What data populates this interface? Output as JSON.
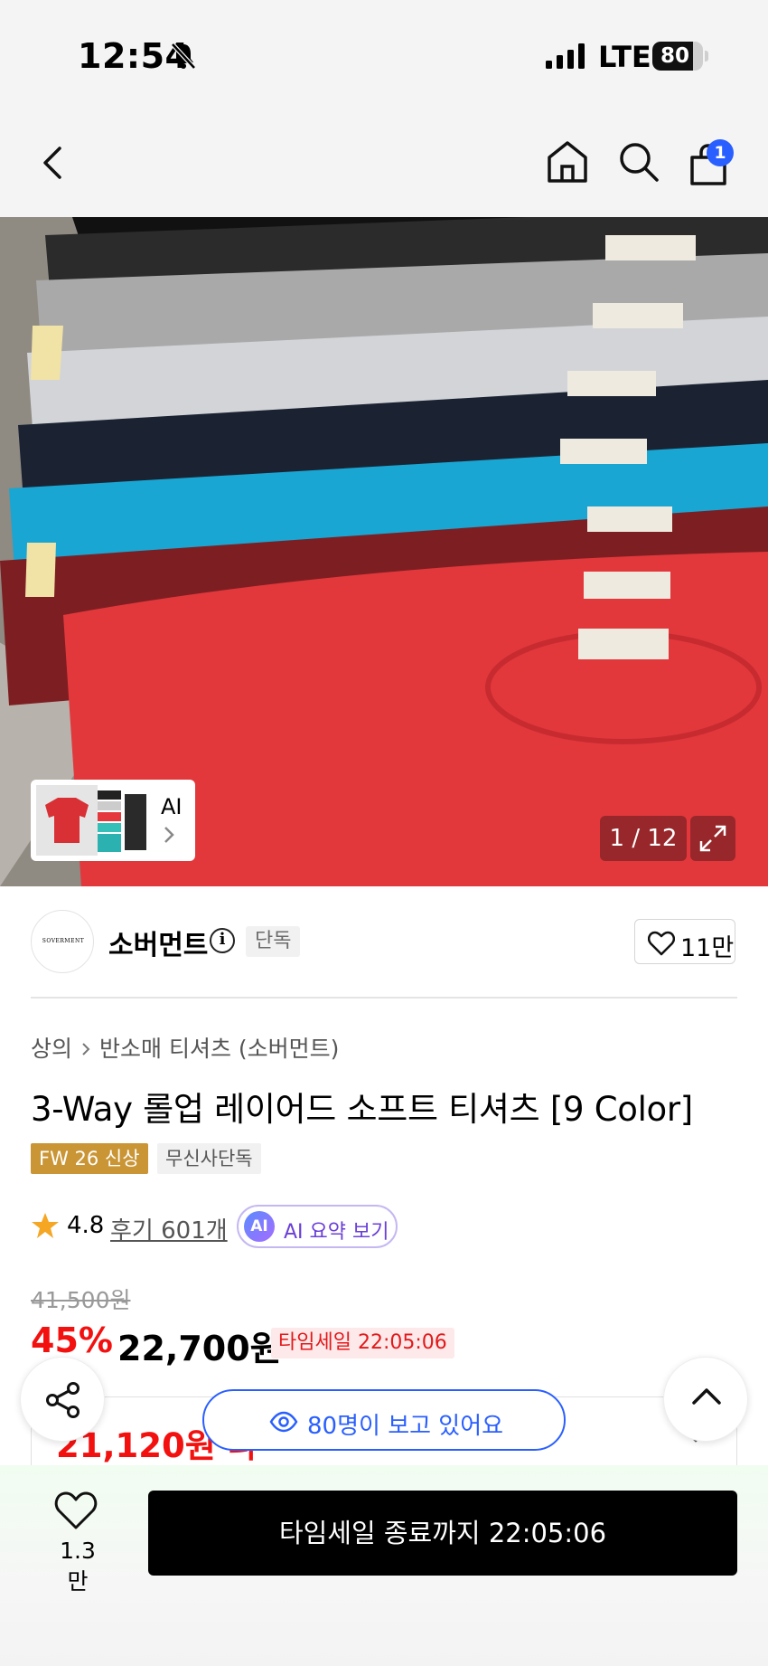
{
  "status_bar": {
    "time": "12:54",
    "network": "LTE",
    "battery": "80",
    "battery_level_percent": 80
  },
  "nav": {
    "cart_badge": "1"
  },
  "gallery": {
    "counter": "1 / 12",
    "ai_label": "AI"
  },
  "brand": {
    "name": "소버먼트",
    "logo_text": "SOVERMENT",
    "tag": "단독",
    "likes": "11만"
  },
  "breadcrumb": [
    "상의",
    "반소매 티셔츠 (소버먼트)"
  ],
  "product": {
    "title": "3-Way 롤업 레이어드 소프트 티셔츠 [9 Color]",
    "tags": [
      "FW 26 신상",
      "무신사단독"
    ],
    "rating": "4.8",
    "reviews": "후기 601개",
    "ai_summary_badge": "AI",
    "ai_summary": "AI 요약 보기"
  },
  "price": {
    "original": "41,500원",
    "discount": "45%",
    "sale": "22,700원",
    "timer_badge": "타임세일 22:05:06",
    "coupon_price": "21,120원 ",
    "coupon_suffix": "나"
  },
  "viewers": "80명이 보고 있어요",
  "bottom": {
    "wish_count": "1.3만",
    "cta": "타임세일 종료까지 22:05:06"
  },
  "colors": {
    "accent_blue": "#2a5fff",
    "sale_red": "#f31110",
    "tag_gold": "#c99535"
  }
}
